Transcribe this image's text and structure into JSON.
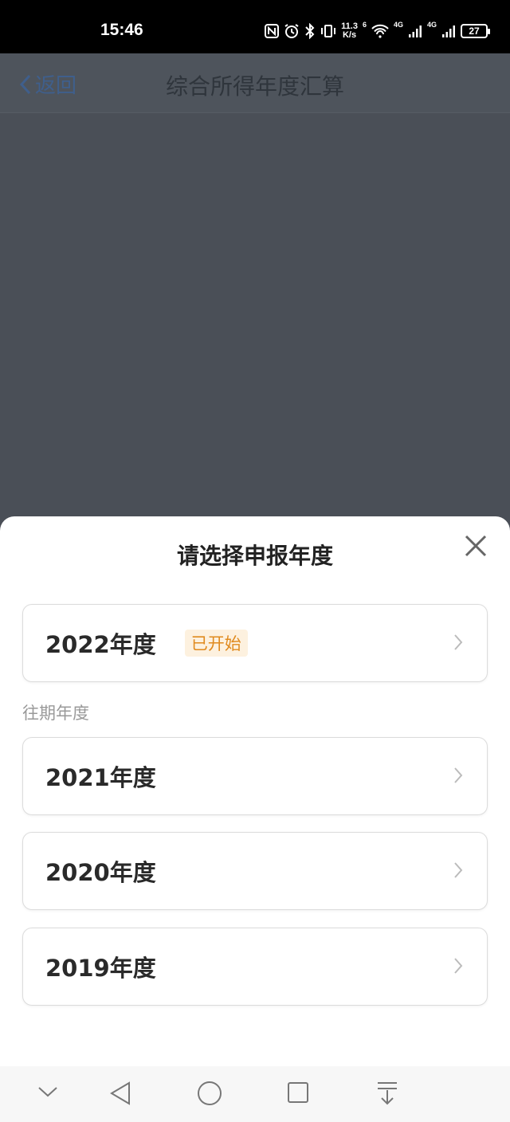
{
  "status_bar": {
    "time": "15:46",
    "net_speed_value": "11.3",
    "net_speed_unit": "K/s",
    "sig1_label": "6",
    "sig2_label": "4G",
    "sig3_label": "4G",
    "battery": "27"
  },
  "nav": {
    "back_label": "返回",
    "title": "综合所得年度汇算"
  },
  "sheet": {
    "title": "请选择申报年度",
    "current": {
      "label": "2022年度",
      "badge": "已开始"
    },
    "past_section_label": "往期年度",
    "past_years": [
      {
        "label": "2021年度"
      },
      {
        "label": "2020年度"
      },
      {
        "label": "2019年度"
      }
    ]
  },
  "colors": {
    "badge_bg": "#fdf1df",
    "badge_text": "#e08a1e",
    "overlay": "#4a4f57"
  }
}
